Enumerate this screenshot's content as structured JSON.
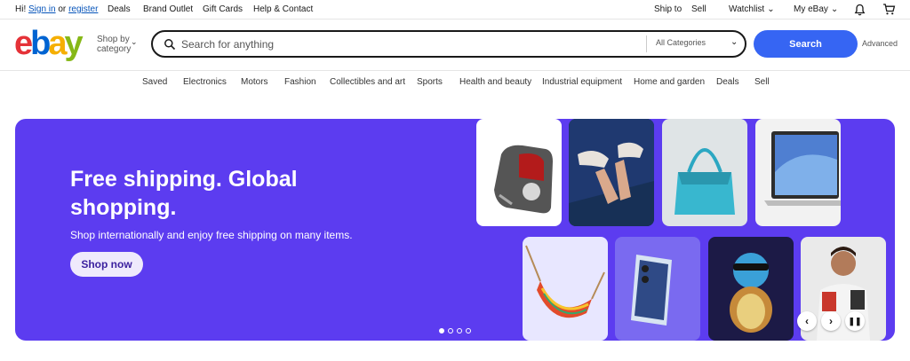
{
  "topbar": {
    "greeting_prefix": "Hi!",
    "sign_in": "Sign in",
    "or": "or",
    "register": "register",
    "links": [
      "Deals",
      "Brand Outlet",
      "Gift Cards",
      "Help & Contact"
    ],
    "ship_to": "Ship to",
    "sell": "Sell",
    "watchlist": "Watchlist",
    "my_ebay": "My eBay",
    "icons": [
      "bell-icon",
      "cart-icon"
    ]
  },
  "header": {
    "logo": {
      "e": "e",
      "b": "b",
      "a": "a",
      "y": "y"
    },
    "shop_by_line1": "Shop by",
    "shop_by_line2": "category",
    "search_placeholder": "Search for anything",
    "category_select": "All Categories",
    "search_button": "Search",
    "advanced": "Advanced"
  },
  "nav": {
    "items": [
      "Saved",
      "Electronics",
      "Motors",
      "Fashion",
      "Collectibles and art",
      "Sports",
      "Health and beauty",
      "Industrial equipment",
      "Home and garden",
      "Deals",
      "Sell"
    ]
  },
  "hero": {
    "title": "Free shipping. Global shopping.",
    "subtitle": "Shop internationally and enjoy free shipping on many items.",
    "cta": "Shop now",
    "slide_count": 4,
    "active_slide": 1
  },
  "colors": {
    "hero_bg": "#5c3cf0",
    "search_button": "#3665f3",
    "logo_e": "#e53238",
    "logo_b": "#0064d2",
    "logo_a": "#f5af02",
    "logo_y": "#86b817"
  }
}
